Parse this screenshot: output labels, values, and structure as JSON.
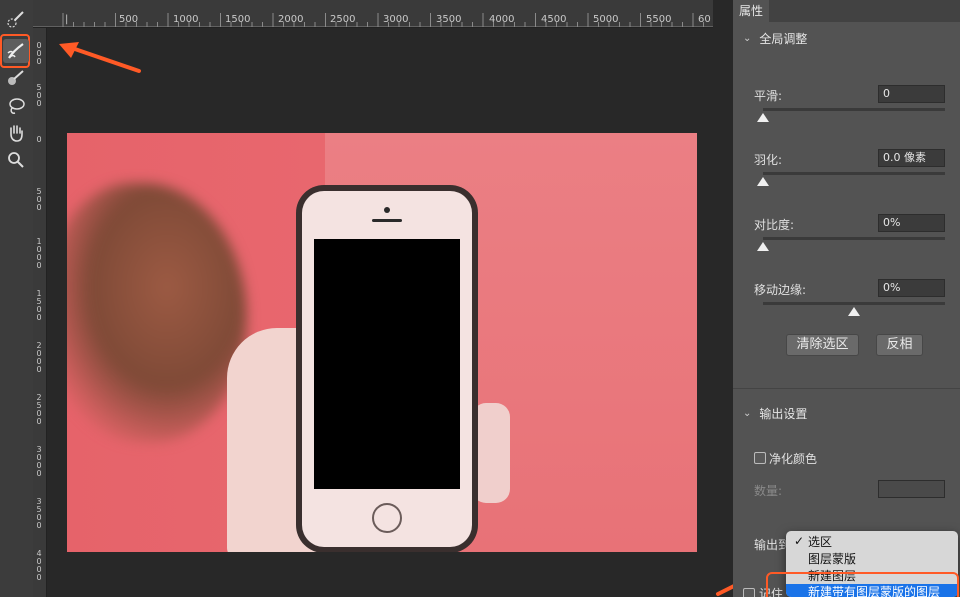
{
  "ruler": {
    "top_labels": [
      "|",
      "500",
      "1000",
      "1500",
      "2000",
      "2500",
      "3000",
      "3500",
      "4000",
      "4500",
      "5000",
      "5500",
      "60"
    ],
    "left_labels": [
      "0\n0\n0",
      "5\n0\n0",
      "0",
      "5\n0\n0",
      "1\n0\n0\n0",
      "1\n5\n0\n0",
      "2\n0\n0\n0",
      "2\n5\n0\n0",
      "3\n0\n0\n0",
      "3\n5\n0\n0",
      "4\n0\n0\n0"
    ]
  },
  "panel": {
    "tab": "属性",
    "global": {
      "header": "全局调整",
      "smooth_label": "平滑:",
      "smooth_value": "0",
      "feather_label": "羽化:",
      "feather_value": "0.0 像素",
      "contrast_label": "对比度:",
      "contrast_value": "0%",
      "shift_label": "移动边缘:",
      "shift_value": "0%",
      "clear_btn": "清除选区",
      "invert_btn": "反相"
    },
    "output": {
      "header": "输出设置",
      "decontaminate": "净化颜色",
      "amount": "数量:",
      "output_to": "输出到",
      "remember": "记住"
    }
  },
  "dropdown": {
    "items": [
      "选区",
      "图层蒙版",
      "新建图层",
      "新建带有图层蒙版的图层"
    ],
    "checked": "✓"
  },
  "colors": {
    "accent": "#ff5a26",
    "selected": "#1a73e8"
  }
}
